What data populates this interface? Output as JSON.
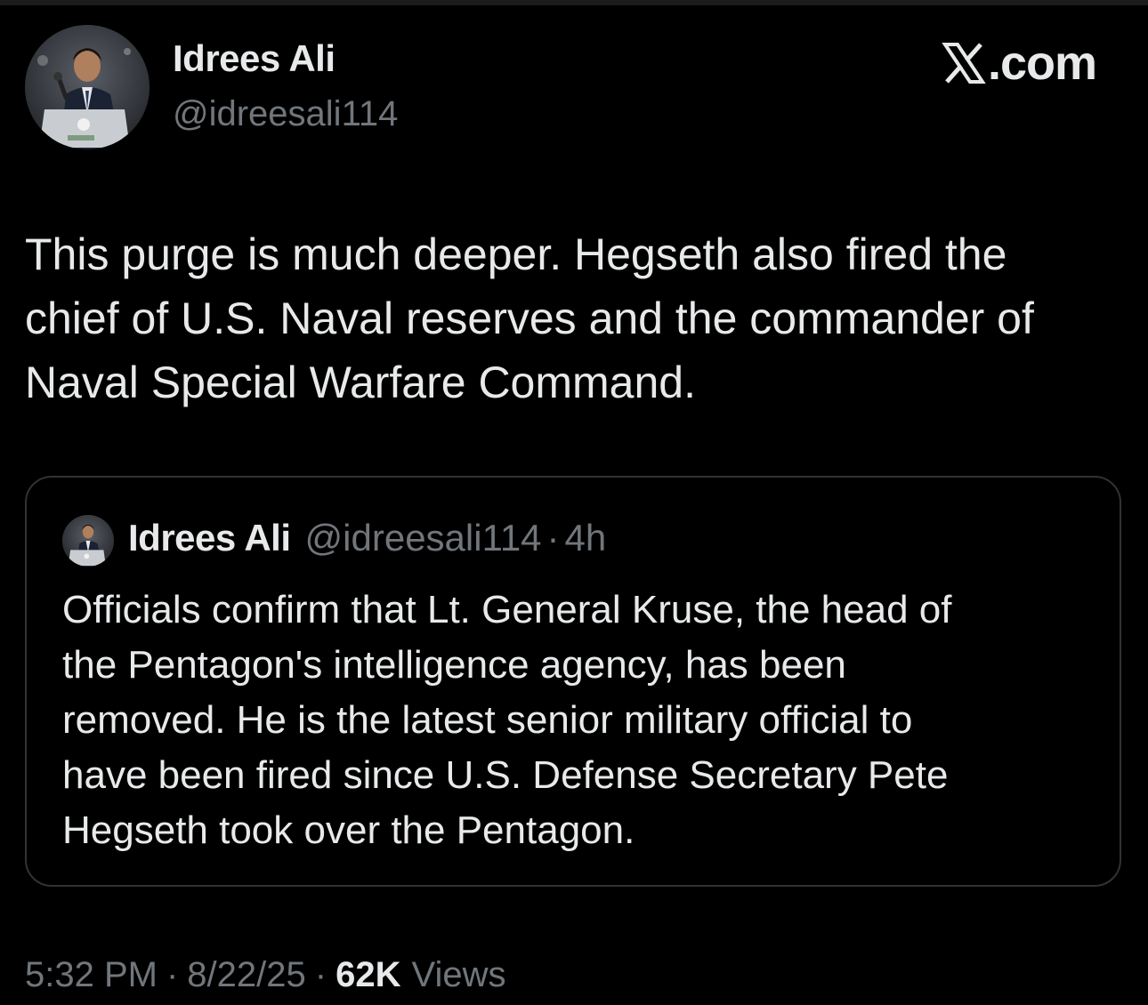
{
  "author": {
    "display_name": "Idrees Ali",
    "handle": "@idreesali114"
  },
  "brand": {
    "label": ".com",
    "icon": "x-logo-icon"
  },
  "tweet": {
    "text": "This purge is much deeper. Hegseth also fired the\nchief of U.S. Naval reserves and the commander of\nNaval Special Warfare Command."
  },
  "quote": {
    "display_name": "Idrees Ali",
    "handle": "@idreesali114",
    "separator": "·",
    "time": "4h",
    "text": "Officials confirm that Lt. General Kruse, the head of\nthe Pentagon's intelligence agency, has been\nremoved. He is the latest senior military official to\nhave been fired since U.S. Defense Secretary Pete\nHegseth took over the Pentagon."
  },
  "meta": {
    "time": "5:32 PM",
    "separator": "·",
    "date": "8/22/25",
    "views_count": "62K",
    "views_label": "Views"
  },
  "colors": {
    "background": "#000000",
    "primary_text": "#e7e9ea",
    "secondary_text": "#71767b",
    "border": "#2f3336"
  }
}
